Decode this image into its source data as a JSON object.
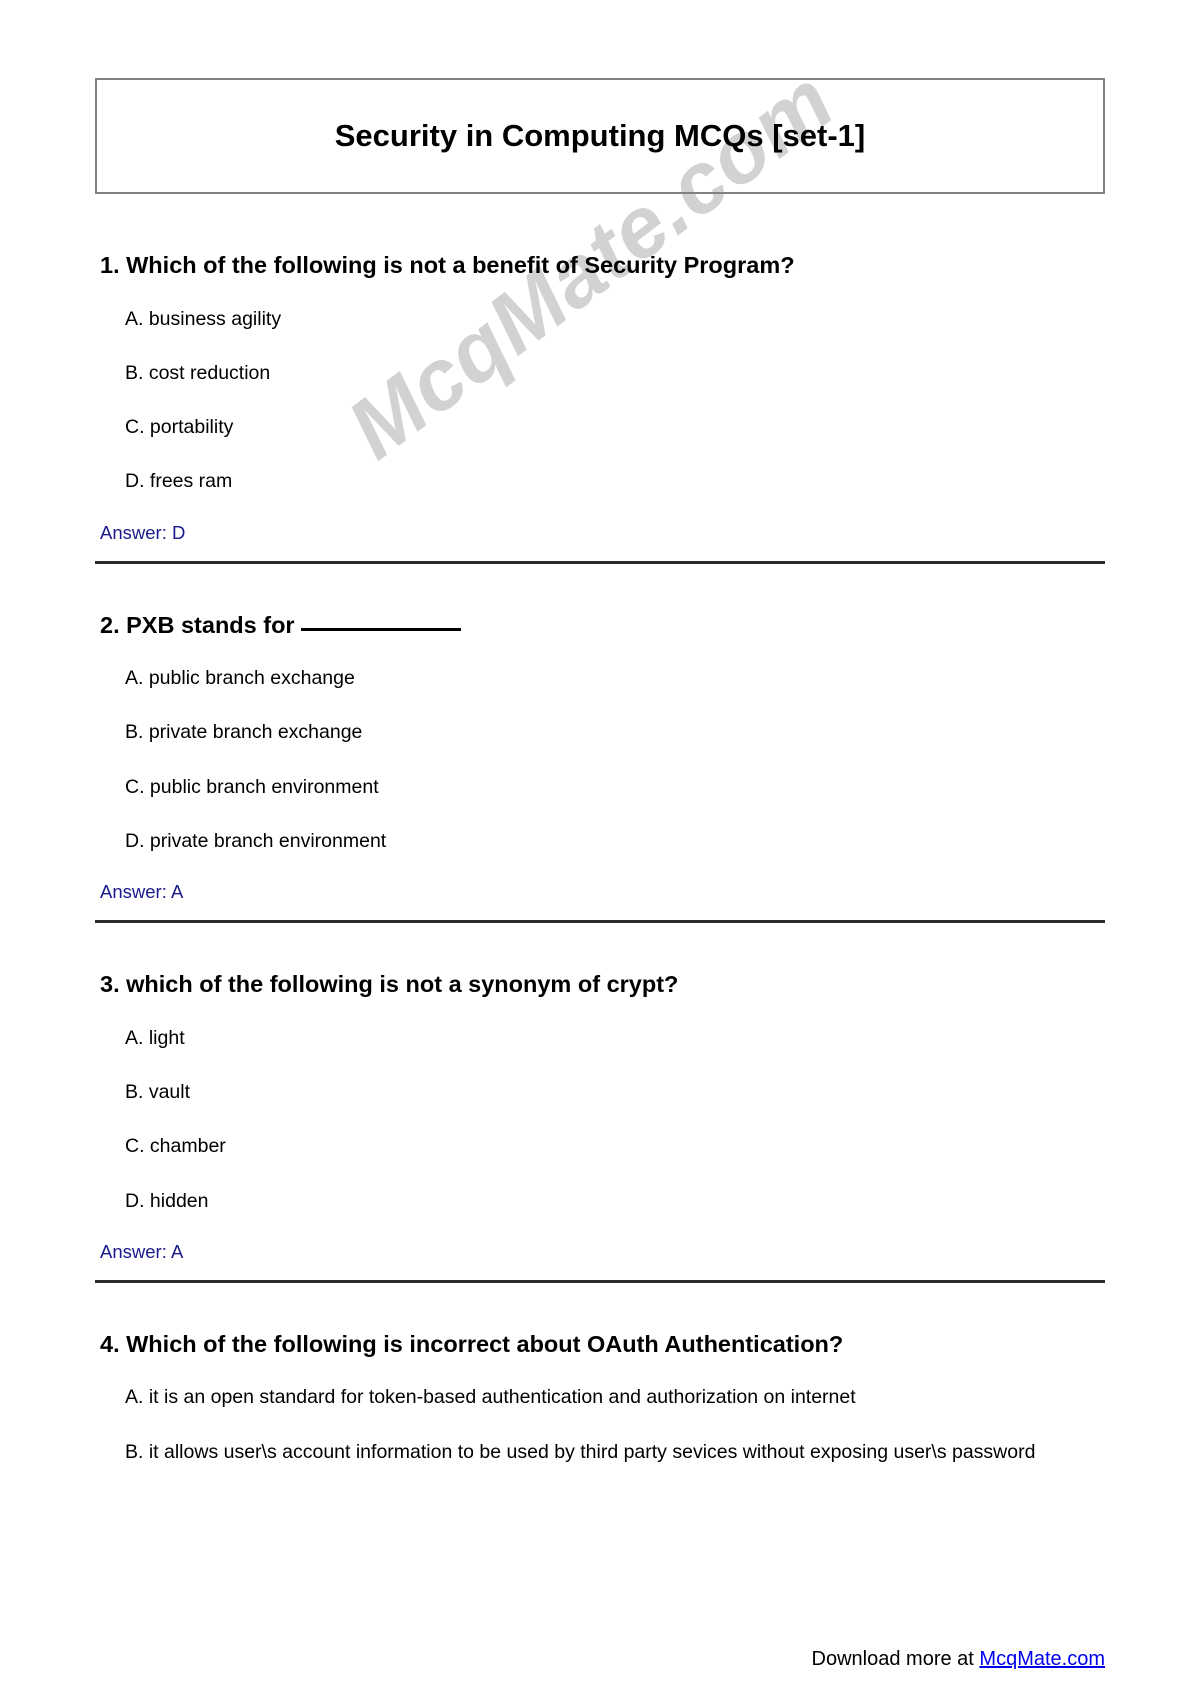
{
  "document": {
    "title": "Security in Computing MCQs [set-1]",
    "watermark": "McqMate.com",
    "answer_color": "#1a1a8c",
    "link_color": "#0000ee"
  },
  "questions": [
    {
      "number_and_text": "1. Which of the following is not a benefit of Security Program?",
      "has_blank": false,
      "options": [
        "A. business agility",
        "B. cost reduction",
        "C. portability",
        "D. frees ram"
      ],
      "answer": "Answer: D"
    },
    {
      "number_and_text": "2. PXB stands for",
      "has_blank": true,
      "options": [
        "A. public branch exchange",
        "B. private branch exchange",
        "C. public branch environment",
        "D. private branch environment"
      ],
      "answer": "Answer: A"
    },
    {
      "number_and_text": "3. which of the following is not a synonym of crypt?",
      "has_blank": false,
      "options": [
        "A. light",
        "B. vault",
        "C. chamber",
        "D. hidden"
      ],
      "answer": "Answer: A"
    },
    {
      "number_and_text": "4. Which of the following is incorrect about OAuth Authentication?",
      "has_blank": false,
      "options": [
        "A. it is an open standard for token-based authentication and authorization on internet",
        "B. it allows user\\s account information to be used by third party sevices without exposing user\\s password"
      ],
      "answer": null
    }
  ],
  "footer": {
    "text": "Download more at ",
    "link_label": "McqMate.com"
  }
}
